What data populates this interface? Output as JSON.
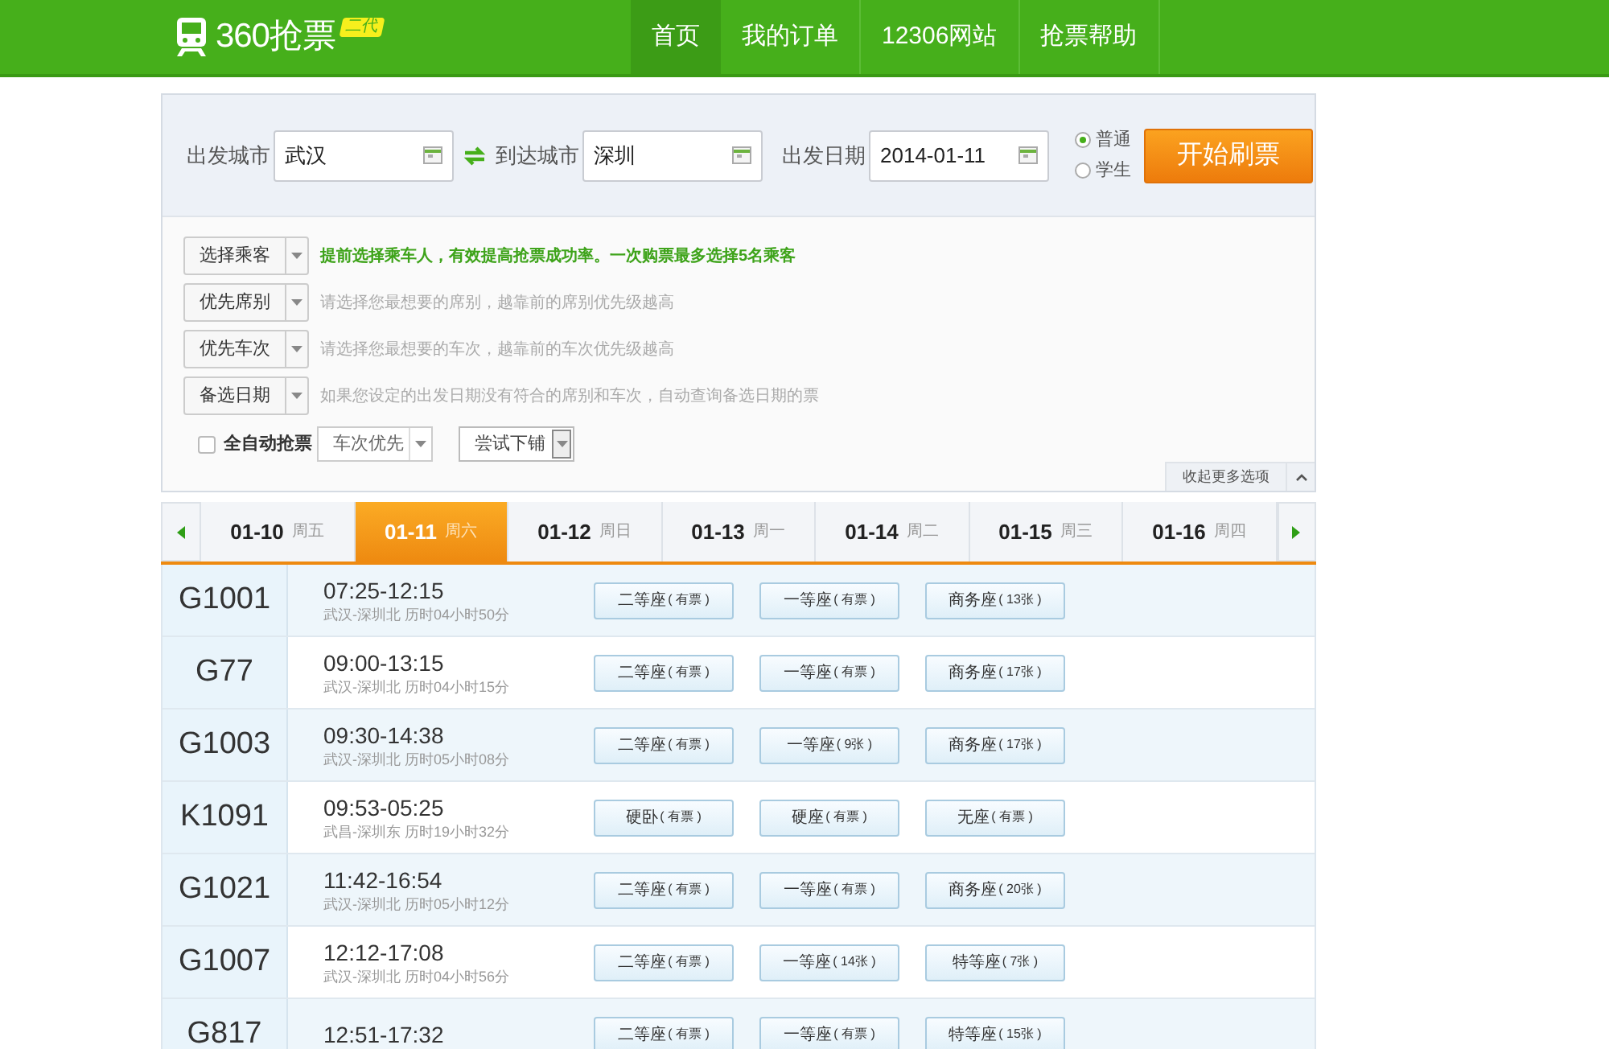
{
  "header": {
    "logo": "360抢票",
    "logo_badge": "二代",
    "nav": [
      {
        "label": "首页",
        "selected": true
      },
      {
        "label": "我的订单",
        "selected": false
      },
      {
        "label": "12306网站",
        "selected": false
      },
      {
        "label": "抢票帮助",
        "selected": false
      }
    ]
  },
  "search": {
    "from_label": "出发城市",
    "from_value": "武汉",
    "to_label": "到达城市",
    "to_value": "深圳",
    "date_label": "出发日期",
    "date_value": "2014-01-11",
    "ticket_types": [
      {
        "label": "普通",
        "selected": true
      },
      {
        "label": "学生",
        "selected": false
      }
    ],
    "submit": "开始刷票"
  },
  "options": [
    {
      "button": "选择乘客",
      "hint": "提前选择乘车人，有效提高抢票成功率。一次购票最多选择5名乘客",
      "highlight": true
    },
    {
      "button": "优先席别",
      "hint": "请选择您最想要的席别，越靠前的席别优先级越高",
      "highlight": false
    },
    {
      "button": "优先车次",
      "hint": "请选择您最想要的车次，越靠前的车次优先级越高",
      "highlight": false
    },
    {
      "button": "备选日期",
      "hint": "如果您设定的出发日期没有符合的席别和车次，自动查询备选日期的票",
      "highlight": false
    }
  ],
  "auto": {
    "label": "全自动抢票",
    "checked": false,
    "priority": "车次优先",
    "berth": "尝试下铺"
  },
  "collapse": "收起更多选项",
  "dates": [
    {
      "date": "01-10",
      "weekday": "周五",
      "selected": false
    },
    {
      "date": "01-11",
      "weekday": "周六",
      "selected": true
    },
    {
      "date": "01-12",
      "weekday": "周日",
      "selected": false
    },
    {
      "date": "01-13",
      "weekday": "周一",
      "selected": false
    },
    {
      "date": "01-14",
      "weekday": "周二",
      "selected": false
    },
    {
      "date": "01-15",
      "weekday": "周三",
      "selected": false
    },
    {
      "date": "01-16",
      "weekday": "周四",
      "selected": false
    }
  ],
  "trains": [
    {
      "number": "G1001",
      "time": "07:25-12:15",
      "route": "武汉-深圳北 历时04小时50分",
      "seats": [
        {
          "name": "二等座",
          "count": "( 有票 )"
        },
        {
          "name": "一等座",
          "count": "( 有票 )"
        },
        {
          "name": "商务座",
          "count": "( 13张 )"
        }
      ]
    },
    {
      "number": "G77",
      "time": "09:00-13:15",
      "route": "武汉-深圳北 历时04小时15分",
      "seats": [
        {
          "name": "二等座",
          "count": "( 有票 )"
        },
        {
          "name": "一等座",
          "count": "( 有票 )"
        },
        {
          "name": "商务座",
          "count": "( 17张 )"
        }
      ]
    },
    {
      "number": "G1003",
      "time": "09:30-14:38",
      "route": "武汉-深圳北 历时05小时08分",
      "seats": [
        {
          "name": "二等座",
          "count": "( 有票 )"
        },
        {
          "name": "一等座",
          "count": "( 9张 )"
        },
        {
          "name": "商务座",
          "count": "( 17张 )"
        }
      ]
    },
    {
      "number": "K1091",
      "time": "09:53-05:25",
      "route": "武昌-深圳东 历时19小时32分",
      "seats": [
        {
          "name": "硬卧",
          "count": "( 有票 )"
        },
        {
          "name": "硬座",
          "count": "( 有票 )"
        },
        {
          "name": "无座",
          "count": "( 有票 )"
        }
      ]
    },
    {
      "number": "G1021",
      "time": "11:42-16:54",
      "route": "武汉-深圳北 历时05小时12分",
      "seats": [
        {
          "name": "二等座",
          "count": "( 有票 )"
        },
        {
          "name": "一等座",
          "count": "( 有票 )"
        },
        {
          "name": "商务座",
          "count": "( 20张 )"
        }
      ]
    },
    {
      "number": "G1007",
      "time": "12:12-17:08",
      "route": "武汉-深圳北 历时04小时56分",
      "seats": [
        {
          "name": "二等座",
          "count": "( 有票 )"
        },
        {
          "name": "一等座",
          "count": "( 14张 )"
        },
        {
          "name": "特等座",
          "count": "( 7张 )"
        }
      ]
    },
    {
      "number": "G817",
      "time": "12:51-17:32",
      "seats": [
        {
          "name": "二等座",
          "count": "( 有票 )"
        },
        {
          "name": "一等座",
          "count": "( 有票 )"
        },
        {
          "name": "特等座",
          "count": "( 15张 )"
        }
      ]
    }
  ]
}
